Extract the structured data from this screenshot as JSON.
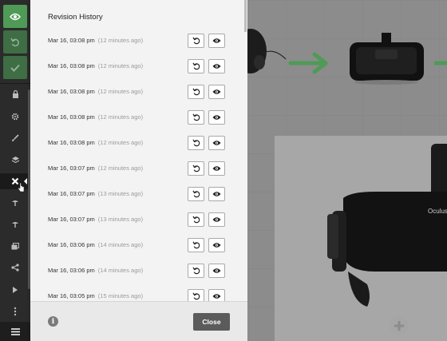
{
  "revision_panel": {
    "title": "Revision History",
    "revisions": [
      {
        "date": "Mar 16, 03:08 pm",
        "ago": "(12 minutes ago)"
      },
      {
        "date": "Mar 16, 03:08 pm",
        "ago": "(12 minutes ago)"
      },
      {
        "date": "Mar 16, 03:08 pm",
        "ago": "(12 minutes ago)"
      },
      {
        "date": "Mar 16, 03:08 pm",
        "ago": "(12 minutes ago)"
      },
      {
        "date": "Mar 16, 03:08 pm",
        "ago": "(12 minutes ago)"
      },
      {
        "date": "Mar 16, 03:07 pm",
        "ago": "(12 minutes ago)"
      },
      {
        "date": "Mar 16, 03:07 pm",
        "ago": "(13 minutes ago)"
      },
      {
        "date": "Mar 16, 03:07 pm",
        "ago": "(13 minutes ago)"
      },
      {
        "date": "Mar 16, 03:06 pm",
        "ago": "(14 minutes ago)"
      },
      {
        "date": "Mar 16, 03:06 pm",
        "ago": "(14 minutes ago)"
      },
      {
        "date": "Mar 16, 03:05 pm",
        "ago": "(15 minutes ago)"
      }
    ],
    "restore_icon": "undo-icon",
    "preview_icon": "eye-icon",
    "info_glyph": "i",
    "close_label": "Close"
  },
  "toolbar": {
    "top_buttons": [
      "eye-icon",
      "undo-icon",
      "check-icon"
    ],
    "tools": [
      "lock-icon",
      "gear-icon",
      "brush-icon",
      "layers-icon",
      "close-x-icon",
      "hotspot-icon",
      "hotspot-alt-icon",
      "media-icon",
      "share-icon",
      "play-icon",
      "more-icon"
    ],
    "menu_icon": "hamburger-icon"
  },
  "canvas": {
    "vr_badge": "Oculus",
    "add_icon": "plus-icon"
  },
  "colors": {
    "toolbar_bg": "#2b2b2b",
    "accent_green": "#4f9a57",
    "panel_bg": "#f3f3f3",
    "canvas_bg": "#8c8c8c",
    "close_bg": "#5b5b5b"
  }
}
